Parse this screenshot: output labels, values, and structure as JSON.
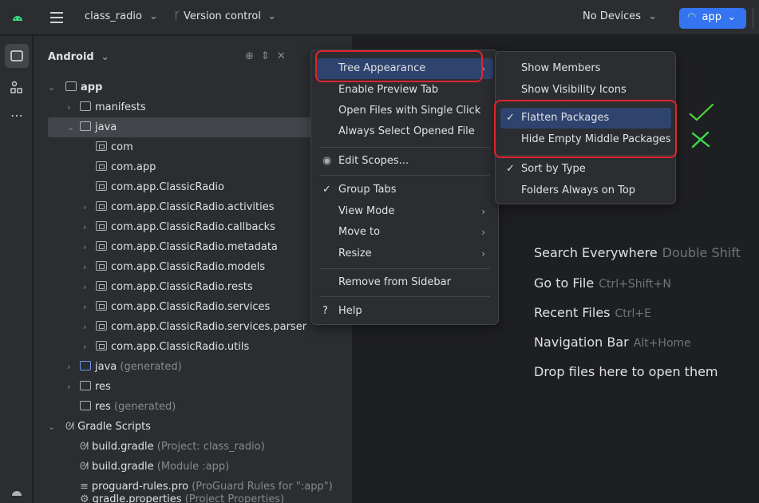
{
  "titlebar": {
    "project_name": "class_radio",
    "version_control": "Version control",
    "devices": "No Devices",
    "run_config": "app"
  },
  "panel": {
    "title": "Android"
  },
  "tree": [
    {
      "label": "app",
      "extra": ""
    },
    {
      "label": "manifests",
      "extra": ""
    },
    {
      "label": "java",
      "extra": ""
    },
    {
      "label": "com",
      "extra": ""
    },
    {
      "label": "com.app",
      "extra": ""
    },
    {
      "label": "com.app.ClassicRadio",
      "extra": ""
    },
    {
      "label": "com.app.ClassicRadio.activities",
      "extra": ""
    },
    {
      "label": "com.app.ClassicRadio.callbacks",
      "extra": ""
    },
    {
      "label": "com.app.ClassicRadio.metadata",
      "extra": ""
    },
    {
      "label": "com.app.ClassicRadio.models",
      "extra": ""
    },
    {
      "label": "com.app.ClassicRadio.rests",
      "extra": ""
    },
    {
      "label": "com.app.ClassicRadio.services",
      "extra": ""
    },
    {
      "label": "com.app.ClassicRadio.services.parser",
      "extra": ""
    },
    {
      "label": "com.app.ClassicRadio.utils",
      "extra": ""
    },
    {
      "label": "java",
      "extra": "(generated)"
    },
    {
      "label": "res",
      "extra": ""
    },
    {
      "label": "res",
      "extra": "(generated)"
    },
    {
      "label": "Gradle Scripts",
      "extra": ""
    },
    {
      "label": "build.gradle",
      "extra": "(Project: class_radio)"
    },
    {
      "label": "build.gradle",
      "extra": "(Module :app)"
    },
    {
      "label": "proguard-rules.pro",
      "extra": "(ProGuard Rules for \":app\")"
    },
    {
      "label": "gradle.properties",
      "extra": "(Project Properties)"
    }
  ],
  "context_menu": {
    "items": [
      "Tree Appearance",
      "Enable Preview Tab",
      "Open Files with Single Click",
      "Always Select Opened File",
      "Edit Scopes...",
      "Group Tabs",
      "View Mode",
      "Move to",
      "Resize",
      "Remove from Sidebar",
      "Help"
    ]
  },
  "submenu": {
    "items": [
      "Show Members",
      "Show Visibility Icons",
      "Flatten Packages",
      "Hide Empty Middle Packages",
      "Sort by Type",
      "Folders Always on Top"
    ]
  },
  "editor_hints": [
    {
      "label": "Search Everywhere",
      "shortcut": "Double Shift"
    },
    {
      "label": "Go to File",
      "shortcut": "Ctrl+Shift+N"
    },
    {
      "label": "Recent Files",
      "shortcut": "Ctrl+E"
    },
    {
      "label": "Navigation Bar",
      "shortcut": "Alt+Home"
    },
    {
      "label": "Drop files here to open them",
      "shortcut": ""
    }
  ],
  "colors": {
    "accent": "#3574f0",
    "annotation_red": "#e0242e",
    "annotation_check": "#4fd13a",
    "annotation_cross": "#3ddc4a"
  }
}
